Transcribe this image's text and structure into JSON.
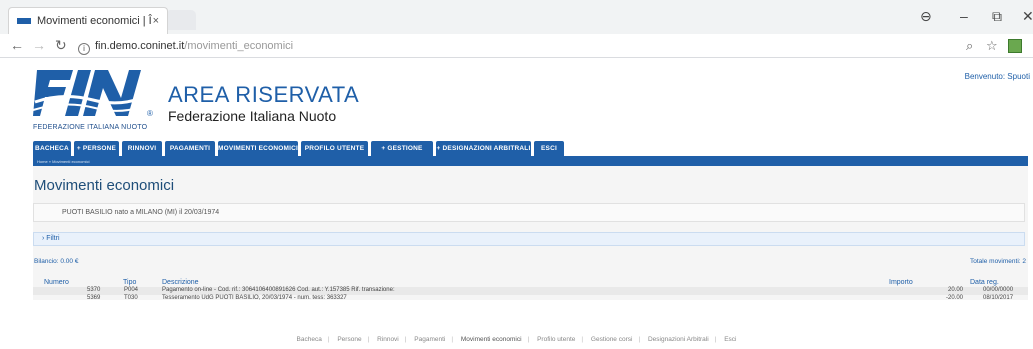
{
  "browser": {
    "tab_title": "Movimenti economici | Î",
    "tab_close": "×",
    "url_host": "fin.demo.coninet.it",
    "url_path": "/movimenti_economici"
  },
  "header": {
    "logo_text": "FIN",
    "logo_subtitle": "FEDERAZIONE ITALIANA NUOTO",
    "area_title": "AREA RISERVATA",
    "federation": "Federazione Italiana Nuoto",
    "welcome": "Benvenuto: Spuoti"
  },
  "menu": [
    {
      "label": "BACHECA"
    },
    {
      "label": "+ PERSONE"
    },
    {
      "label": "RINNOVI"
    },
    {
      "label": "PAGAMENTI"
    },
    {
      "label": "MOVIMENTI ECONOMICI"
    },
    {
      "label": "PROFILO UTENTE"
    },
    {
      "label": "+ GESTIONE CORSI"
    },
    {
      "label": "+ DESIGNAZIONI ARBITRALI"
    },
    {
      "label": "ESCI"
    }
  ],
  "breadcrumb": "Home » Movimenti economici",
  "page": {
    "title": "Movimenti economici",
    "person": "PUOTI BASILIO nato a MILANO (MI) il 20/03/1974",
    "filter_label": "› Filtri",
    "bilancio": "Bilancio: 0.00 €",
    "totale": "Totale movimenti: 2"
  },
  "table": {
    "headers": {
      "numero": "Numero",
      "tipo": "Tipo",
      "descrizione": "Descrizione",
      "importo": "Importo",
      "data": "Data reg."
    },
    "rows": [
      {
        "numero": "5370",
        "tipo": "P004",
        "descrizione": "Pagamento on-line - Cod. rif.: 3064106400891626 Cod. aut.: Y.157385 Rif. transazione:",
        "importo": "20.00",
        "data": "00/00/0000"
      },
      {
        "numero": "5369",
        "tipo": "T030",
        "descrizione": "Tesseramento UdG PUOTI BASILIO, 20/03/1974 - num. tess: 363327",
        "importo": "-20.00",
        "data": "08/10/2017"
      }
    ]
  },
  "footer": [
    "Bacheca",
    "Persone",
    "Rinnovi",
    "Pagamenti",
    "Movimenti economici",
    "Profilo utente",
    "Gestione corsi",
    "Designazioni Arbitrali",
    "Esci"
  ],
  "colors": {
    "brand_blue": "#1f5fa8",
    "dark_blue": "#1f4e79"
  }
}
